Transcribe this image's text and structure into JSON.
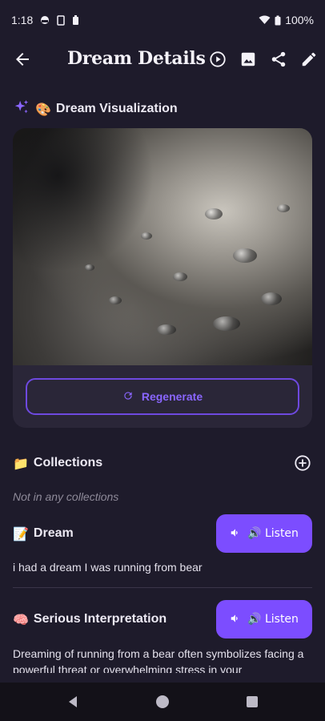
{
  "status_bar": {
    "time": "1:18",
    "battery": "100%"
  },
  "app_bar": {
    "title": "Dream Details",
    "icons": [
      "arrow-back-icon",
      "play-icon",
      "image-icon",
      "share-icon",
      "edit-icon"
    ]
  },
  "visualization": {
    "emoji": "🎨",
    "title": "Dream Visualization",
    "regenerate_label": "Regenerate"
  },
  "collections": {
    "emoji": "📁",
    "title": "Collections",
    "empty_text": "Not in any collections"
  },
  "dream": {
    "emoji": "📝",
    "title": "Dream",
    "listen_label": "🔊 Listen",
    "text": "i had a dream I was running from bear"
  },
  "interpretation": {
    "emoji": "🧠",
    "title": "Serious Interpretation",
    "listen_label": "🔊 Listen",
    "text": "Dreaming of running from a bear often symbolizes facing a powerful threat or overwhelming stress in your"
  },
  "colors": {
    "background": "#1e1b2b",
    "accent": "#7c4dff",
    "card": "#2a2638"
  }
}
